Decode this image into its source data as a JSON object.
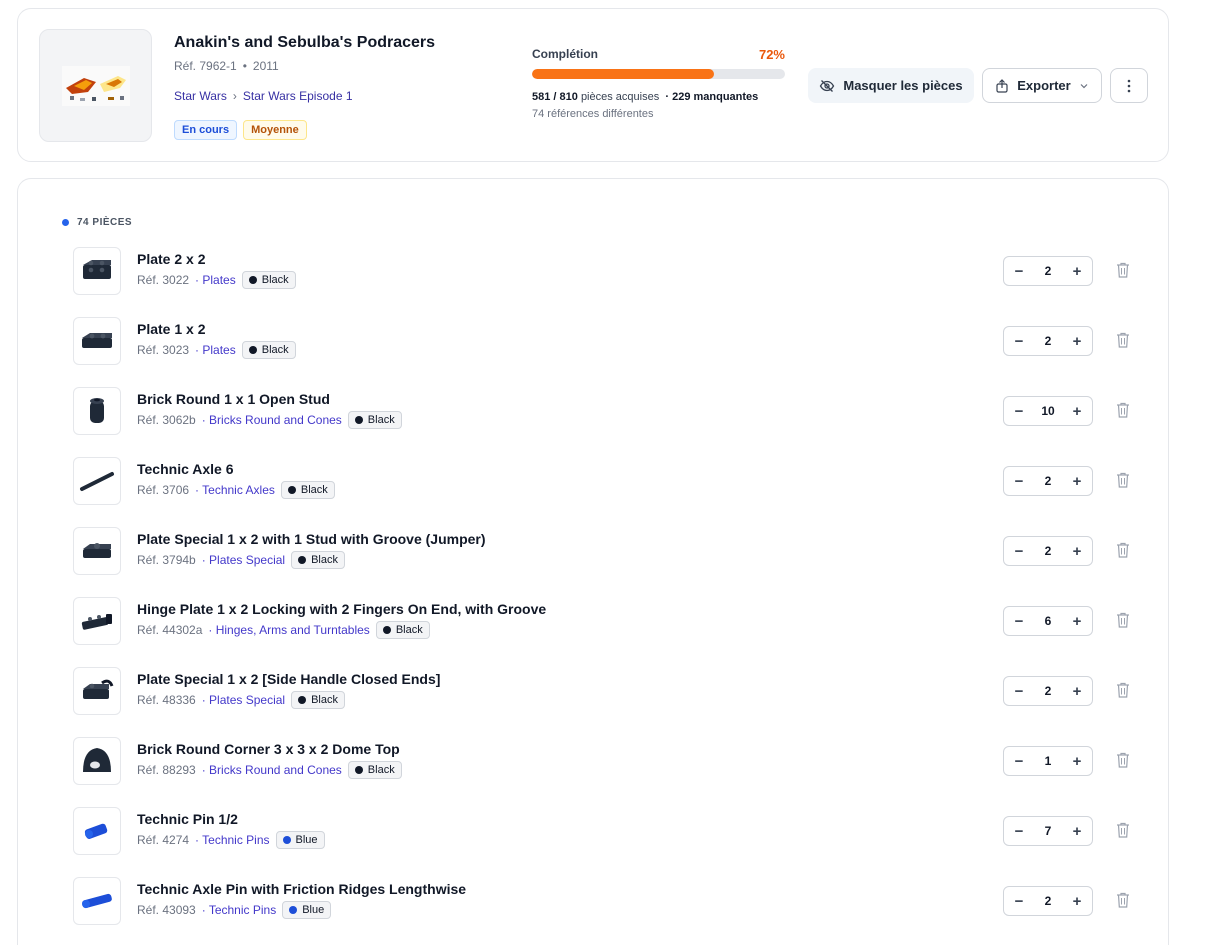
{
  "set": {
    "title": "Anakin's and Sebulba's Podracers",
    "ref": "Réf. 7962-1",
    "sep": "•",
    "year": "2011",
    "breadcrumb": [
      "Star Wars",
      "Star Wars Episode 1"
    ],
    "breadcrumb_sep": "›",
    "badges": [
      {
        "label": "En cours",
        "tone": "blue"
      },
      {
        "label": "Moyenne",
        "tone": "yellow"
      }
    ],
    "image_icon": "set-thumbnail-image"
  },
  "completion": {
    "label": "Complétion",
    "percent_label": "72%",
    "percent": 0.72,
    "acquired": "581 / 810",
    "acquired_suffix": "pièces acquises",
    "missing_prefix": "·",
    "missing": "229 manquantes",
    "distinct_refs": "74 références différentes",
    "bar_color": "#f97316",
    "accent_color": "#ea580c"
  },
  "actions": {
    "hide_label": "Masquer les pièces",
    "hide_icon": "eye-off-icon",
    "export_label": "Exporter",
    "export_icon": "export-icon",
    "more_icon": "more-vertical-icon"
  },
  "list": {
    "section_label": "74 PIÈCES",
    "pieces": [
      {
        "name": "Plate 2 x 2",
        "ref": "Réf. 3022",
        "category": "· Plates",
        "color": "Black",
        "color_hex": "#111827",
        "qty": "2",
        "shape": "plate2x2"
      },
      {
        "name": "Plate 1 x 2",
        "ref": "Réf. 3023",
        "category": "· Plates",
        "color": "Black",
        "color_hex": "#111827",
        "qty": "2",
        "shape": "plate1x2"
      },
      {
        "name": "Brick Round 1 x 1 Open Stud",
        "ref": "Réf. 3062b",
        "category": "· Bricks Round and Cones",
        "color": "Black",
        "color_hex": "#111827",
        "qty": "10",
        "shape": "round"
      },
      {
        "name": "Technic Axle 6",
        "ref": "Réf. 3706",
        "category": "· Technic Axles",
        "color": "Black",
        "color_hex": "#111827",
        "qty": "2",
        "shape": "axle"
      },
      {
        "name": "Plate Special 1 x 2 with 1 Stud with Groove (Jumper)",
        "ref": "Réf. 3794b",
        "category": "· Plates Special",
        "color": "Black",
        "color_hex": "#111827",
        "qty": "2",
        "shape": "jumper"
      },
      {
        "name": "Hinge Plate 1 x 2 Locking with 2 Fingers On End, with Groove",
        "ref": "Réf. 44302a",
        "category": "· Hinges, Arms and Turntables",
        "color": "Black",
        "color_hex": "#111827",
        "qty": "6",
        "shape": "hinge"
      },
      {
        "name": "Plate Special 1 x 2 [Side Handle Closed Ends]",
        "ref": "Réf. 48336",
        "category": "· Plates Special",
        "color": "Black",
        "color_hex": "#111827",
        "qty": "2",
        "shape": "handle"
      },
      {
        "name": "Brick Round Corner 3 x 3 x 2 Dome Top",
        "ref": "Réf. 88293",
        "category": "· Bricks Round and Cones",
        "color": "Black",
        "color_hex": "#111827",
        "qty": "1",
        "shape": "dome"
      },
      {
        "name": "Technic Pin 1/2",
        "ref": "Réf. 4274",
        "category": "· Technic Pins",
        "color": "Blue",
        "color_hex": "#1d4ed8",
        "qty": "7",
        "shape": "pin"
      },
      {
        "name": "Technic Axle Pin with Friction Ridges Lengthwise",
        "ref": "Réf. 43093",
        "category": "· Technic Pins",
        "color": "Blue",
        "color_hex": "#1d4ed8",
        "qty": "2",
        "shape": "axlepin"
      }
    ],
    "minus_label": "−",
    "plus_label": "+",
    "delete_icon": "trash-icon"
  }
}
